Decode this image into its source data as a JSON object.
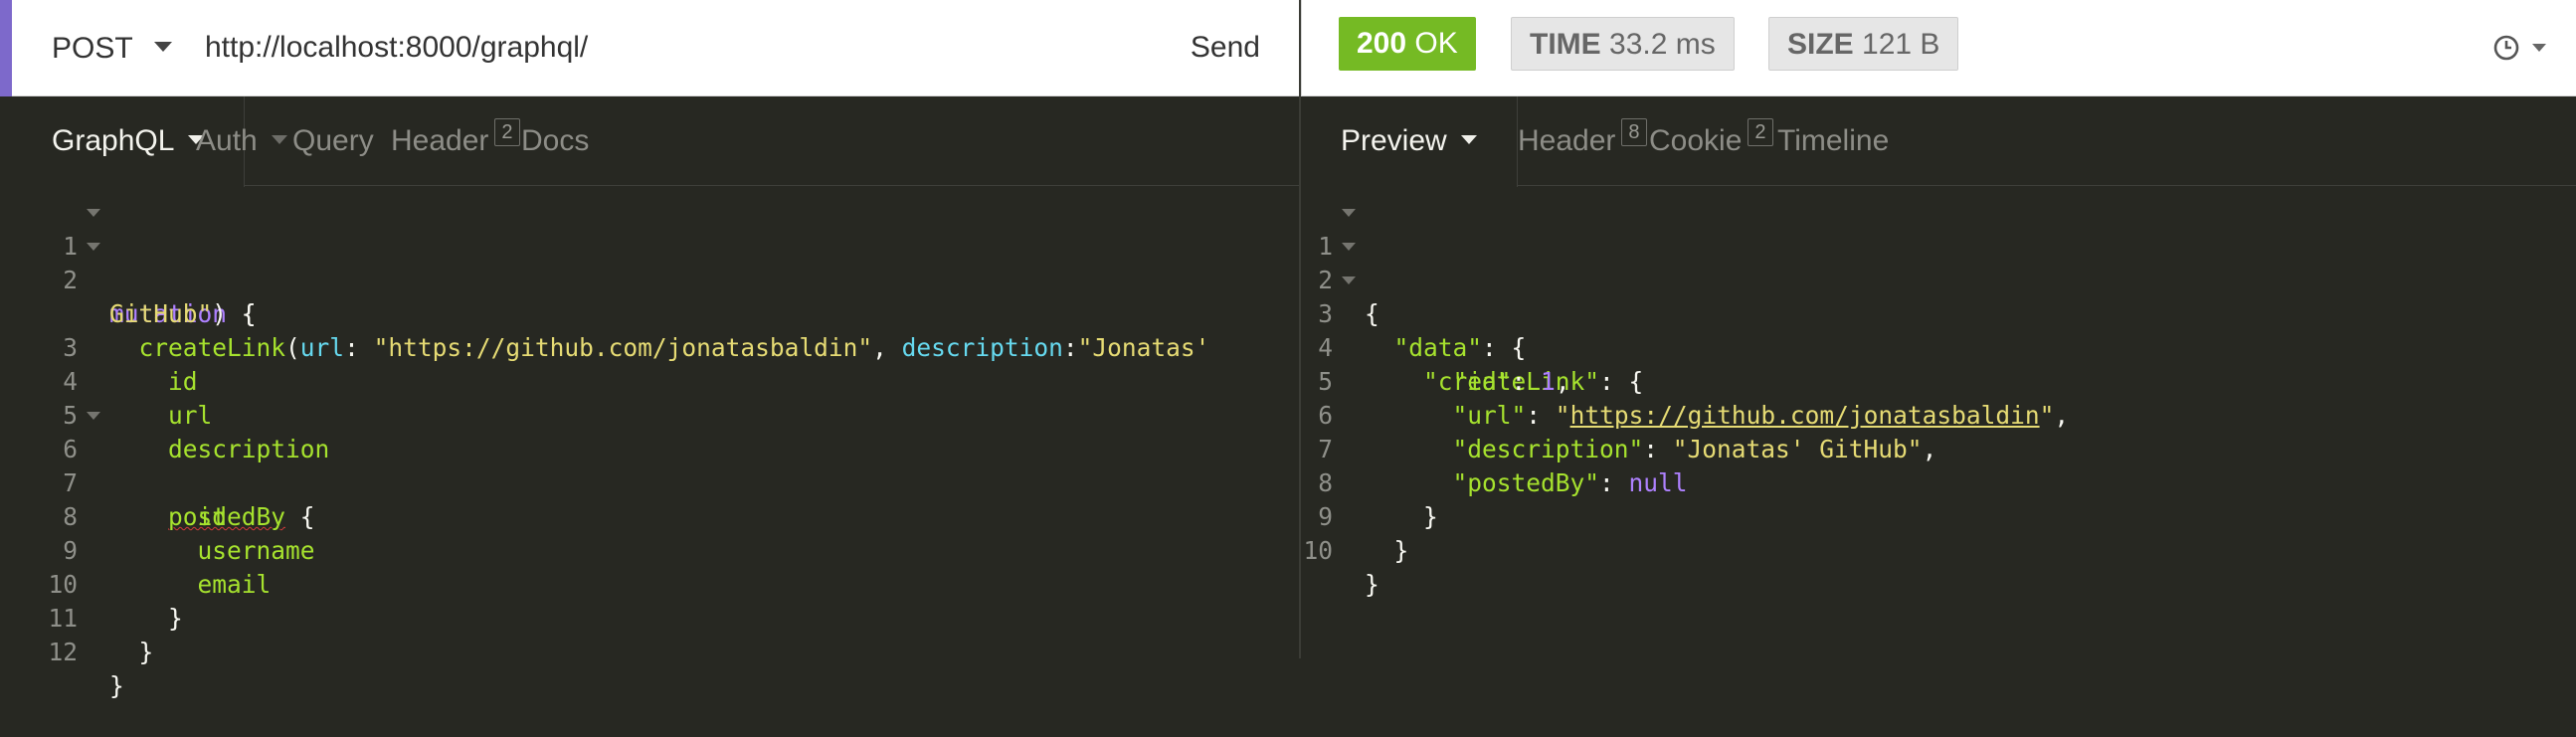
{
  "request": {
    "method": "POST",
    "url": "http://localhost:8000/graphql/",
    "send_label": "Send",
    "tabs": [
      {
        "label": "GraphQL",
        "count": ""
      },
      {
        "label": "Auth",
        "count": ""
      },
      {
        "label": "Query",
        "count": ""
      },
      {
        "label": "Header",
        "count": "2"
      },
      {
        "label": "Docs",
        "count": ""
      }
    ]
  },
  "response": {
    "status_code": "200",
    "status_text": "OK",
    "time_label": "TIME",
    "time_value": "33.2 ms",
    "size_label": "SIZE",
    "size_value": "121 B",
    "tabs": [
      {
        "label": "Preview",
        "count": ""
      },
      {
        "label": "Header",
        "count": "8"
      },
      {
        "label": "Cookie",
        "count": "2"
      },
      {
        "label": "Timeline",
        "count": ""
      }
    ]
  },
  "query_editor": {
    "line_numbers": [
      "1",
      "2",
      "",
      "3",
      "4",
      "5",
      "6",
      "7",
      "8",
      "9",
      "10",
      "11",
      "12"
    ],
    "l1_kw": "mutation",
    "l1_rest": " {",
    "l2_indent": "  ",
    "l2_fn": "createLink",
    "l2_open": "(",
    "l2_arg1": "url",
    "l2_colon1": ": ",
    "l2_val1": "\"https://github.com/jonatasbaldin\"",
    "l2_sep": ", ",
    "l2_arg2": "description",
    "l2_colon2": ":",
    "l2_val2a": "\"Jonatas'",
    "l2_val2b": "GitHub\"",
    "l2_close": ") {",
    "l3": "id",
    "l4": "url",
    "l5": "description",
    "l6": "postedBy",
    "l6_rest": " {",
    "l7": "id",
    "l8": "username",
    "l9": "email",
    "l10": "}",
    "l11": "}",
    "l12": "}"
  },
  "response_body": {
    "line_numbers": [
      "1",
      "2",
      "3",
      "4",
      "5",
      "6",
      "7",
      "8",
      "9",
      "10"
    ],
    "l1": "{",
    "k_data": "\"data\"",
    "l2_rest": ": {",
    "k_create": "\"createLink\"",
    "l3_rest": ": {",
    "k_id": "\"id\"",
    "v_id": "1",
    "comma": ",",
    "k_url": "\"url\"",
    "v_url_q": "\"",
    "v_url": "https://github.com/jonatasbaldin",
    "k_desc": "\"description\"",
    "v_desc": "\"Jonatas' GitHub\"",
    "k_posted": "\"postedBy\"",
    "v_posted": "null",
    "colon": ": ",
    "l8": "}",
    "l9": "}",
    "l10": "}"
  },
  "colors": {
    "accent": "#7d69cb",
    "status_ok": "#75ba24",
    "editor_bg": "#272822"
  },
  "icons": {
    "history": "clock-icon",
    "dropdown": "chevron-down-icon"
  }
}
